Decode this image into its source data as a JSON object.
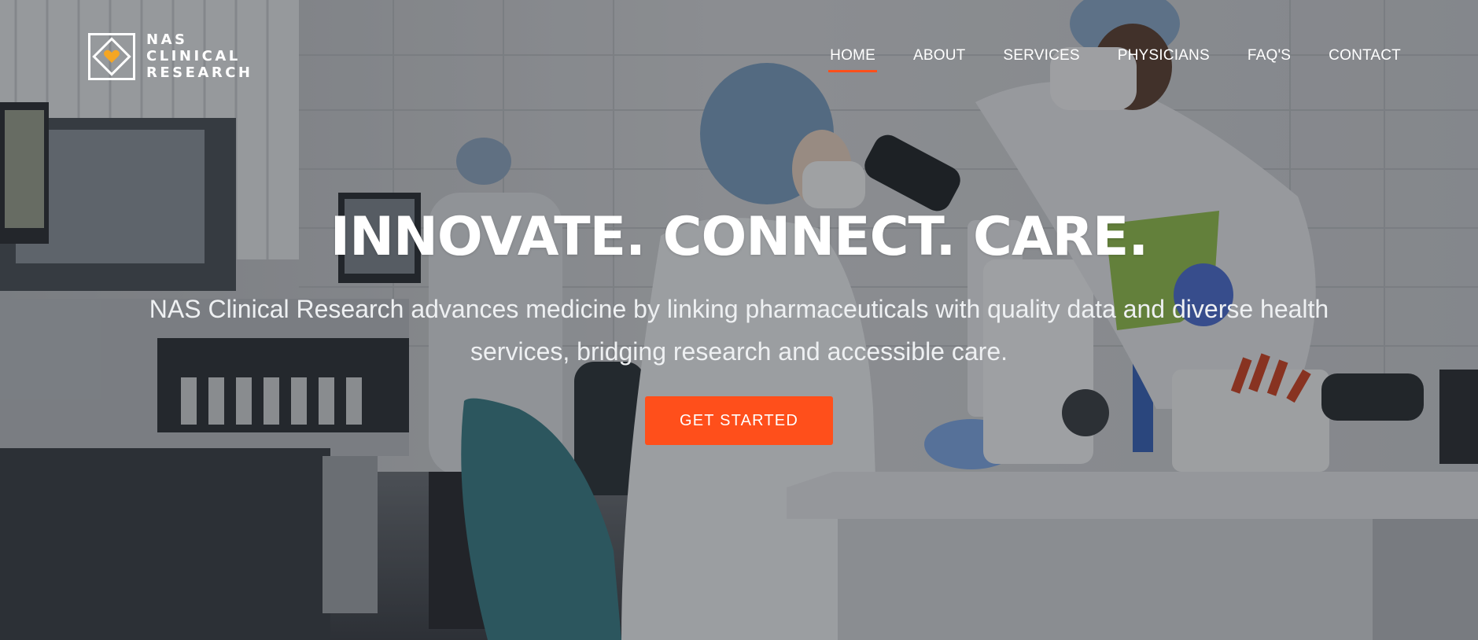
{
  "brand": {
    "logo_icon": "diamond-heart-logo-icon",
    "name_lines": [
      "NAS",
      "CLINICAL",
      "RESEARCH"
    ],
    "accent_color": "#ff4f1b",
    "heart_color": "#f5a623"
  },
  "nav": {
    "items": [
      {
        "label": "HOME",
        "active": true
      },
      {
        "label": "ABOUT",
        "active": false
      },
      {
        "label": "SERVICES",
        "active": false
      },
      {
        "label": "PHYSICIANS",
        "active": false
      },
      {
        "label": "FAQ'S",
        "active": false
      },
      {
        "label": "CONTACT",
        "active": false
      }
    ]
  },
  "hero": {
    "headline": "INNOVATE. CONNECT. CARE.",
    "subtext": "NAS Clinical Research advances medicine by linking pharmaceuticals with quality data and diverse health services, bridging research and accessible care.",
    "cta_label": "GET STARTED",
    "background": "lab-researchers-photo"
  }
}
